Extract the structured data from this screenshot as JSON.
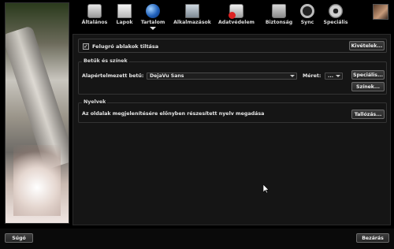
{
  "toolbar": {
    "items": [
      {
        "label": "Általános",
        "icon": "general-icon"
      },
      {
        "label": "Lapok",
        "icon": "tabs-icon"
      },
      {
        "label": "Tartalom",
        "icon": "content-globe-icon",
        "active": true
      },
      {
        "label": "Alkalmazások",
        "icon": "applications-icon"
      },
      {
        "label": "Adatvédelem",
        "icon": "privacy-icon"
      },
      {
        "label": "Biztonság",
        "icon": "security-lock-icon"
      },
      {
        "label": "Sync",
        "icon": "sync-icon"
      },
      {
        "label": "Speciális",
        "icon": "advanced-gear-icon"
      }
    ]
  },
  "content": {
    "popup": {
      "checkbox_checked": true,
      "label": "Felugró ablakok tiltása",
      "exceptions_button": "Kivételek..."
    },
    "fonts": {
      "title": "Betűk és színek",
      "default_font_label": "Alapértelmezett betű:",
      "default_font_value": "DejaVu Sans",
      "size_label": "Méret:",
      "size_value": "...",
      "advanced_button": "Speciális...",
      "colors_button": "Színek..."
    },
    "languages": {
      "title": "Nyelvek",
      "description": "Az oldalak megjelenítésére előnyben részesített nyelv megadása",
      "choose_button": "Tallózás..."
    }
  },
  "footer": {
    "help_button": "Súgó",
    "close_button": "Bezárás"
  }
}
